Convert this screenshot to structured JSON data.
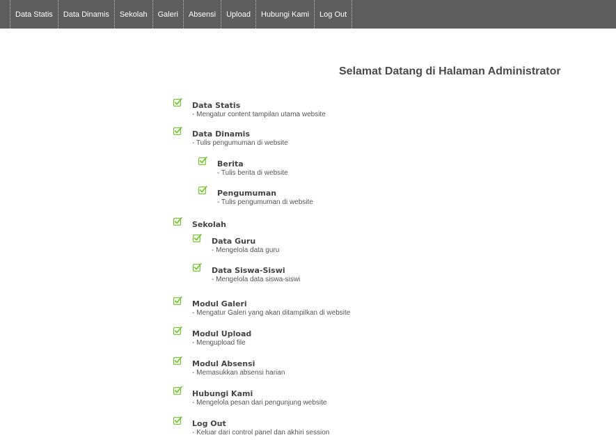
{
  "nav": {
    "items": [
      "Data Statis",
      "Data Dinamis",
      "Sekolah",
      "Galeri",
      "Absensi",
      "Upload",
      "Hubungi Kami",
      "Log Out"
    ]
  },
  "main": {
    "title": "Selamat Datang di Halaman Administrator",
    "items": [
      {
        "title": "Data Statis",
        "desc": "- Mengatur content tampilan utama website"
      },
      {
        "title": "Data Dinamis",
        "desc": "- Tulis pengumuman di website"
      },
      {
        "title": "Berita",
        "desc": "- Tulis berita di website"
      },
      {
        "title": "Pengumuman",
        "desc": "- Tulis pengumuman di website"
      },
      {
        "title": "Sekolah",
        "desc": ""
      },
      {
        "title": "Data Guru",
        "desc": "- Mengelola data guru"
      },
      {
        "title": "Data Siswa-Siswi",
        "desc": "- Mengelola data siswa-siswi"
      },
      {
        "title": "Modul Galeri",
        "desc": "- Mengatur Galeri yang akan ditampilkan di website"
      },
      {
        "title": "Modul Upload",
        "desc": "- Mengupload file"
      },
      {
        "title": "Modul Absensi",
        "desc": "- Memasukkan absensi harian"
      },
      {
        "title": "Hubungi Kami",
        "desc": "- Mengelola pesan dari pengunjung website"
      },
      {
        "title": "Log Out",
        "desc": "- Keluar dari control panel dan akhiri session"
      }
    ]
  },
  "colors": {
    "nav_bg": "#5e5e5e",
    "check_green": "#7dc242"
  },
  "icons": {
    "list_marker": "checkbox-checked-icon"
  }
}
